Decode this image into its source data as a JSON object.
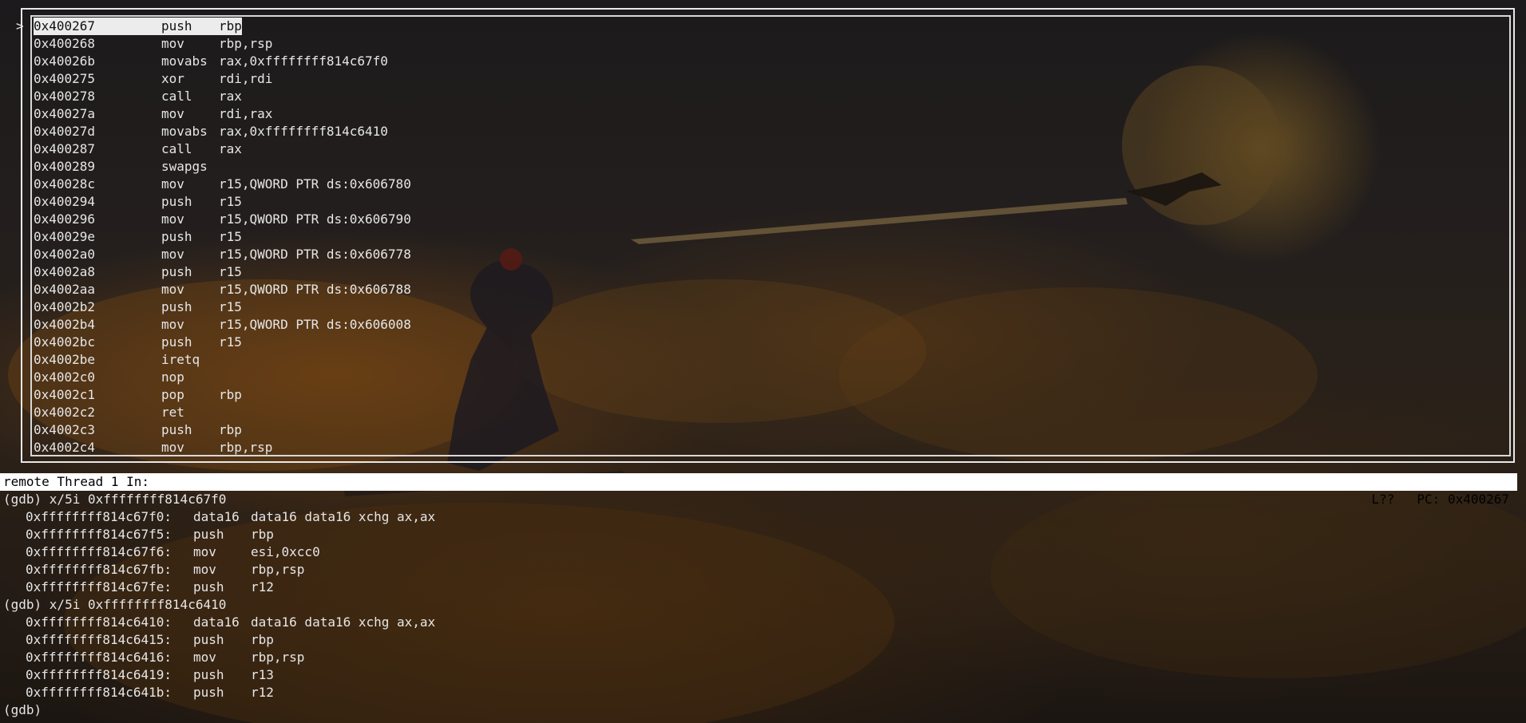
{
  "asm": {
    "cursor_marker": ">",
    "lines": [
      {
        "addr": "0x400267",
        "mnemonic": "push",
        "operands": "rbp"
      },
      {
        "addr": "0x400268",
        "mnemonic": "mov",
        "operands": "rbp,rsp"
      },
      {
        "addr": "0x40026b",
        "mnemonic": "movabs",
        "operands": "rax,0xffffffff814c67f0"
      },
      {
        "addr": "0x400275",
        "mnemonic": "xor",
        "operands": "rdi,rdi"
      },
      {
        "addr": "0x400278",
        "mnemonic": "call",
        "operands": "rax"
      },
      {
        "addr": "0x40027a",
        "mnemonic": "mov",
        "operands": "rdi,rax"
      },
      {
        "addr": "0x40027d",
        "mnemonic": "movabs",
        "operands": "rax,0xffffffff814c6410"
      },
      {
        "addr": "0x400287",
        "mnemonic": "call",
        "operands": "rax"
      },
      {
        "addr": "0x400289",
        "mnemonic": "swapgs",
        "operands": ""
      },
      {
        "addr": "0x40028c",
        "mnemonic": "mov",
        "operands": "r15,QWORD PTR ds:0x606780"
      },
      {
        "addr": "0x400294",
        "mnemonic": "push",
        "operands": "r15"
      },
      {
        "addr": "0x400296",
        "mnemonic": "mov",
        "operands": "r15,QWORD PTR ds:0x606790"
      },
      {
        "addr": "0x40029e",
        "mnemonic": "push",
        "operands": "r15"
      },
      {
        "addr": "0x4002a0",
        "mnemonic": "mov",
        "operands": "r15,QWORD PTR ds:0x606778"
      },
      {
        "addr": "0x4002a8",
        "mnemonic": "push",
        "operands": "r15"
      },
      {
        "addr": "0x4002aa",
        "mnemonic": "mov",
        "operands": "r15,QWORD PTR ds:0x606788"
      },
      {
        "addr": "0x4002b2",
        "mnemonic": "push",
        "operands": "r15"
      },
      {
        "addr": "0x4002b4",
        "mnemonic": "mov",
        "operands": "r15,QWORD PTR ds:0x606008"
      },
      {
        "addr": "0x4002bc",
        "mnemonic": "push",
        "operands": "r15"
      },
      {
        "addr": "0x4002be",
        "mnemonic": "iretq",
        "operands": ""
      },
      {
        "addr": "0x4002c0",
        "mnemonic": "nop",
        "operands": ""
      },
      {
        "addr": "0x4002c1",
        "mnemonic": "pop",
        "operands": "rbp"
      },
      {
        "addr": "0x4002c2",
        "mnemonic": "ret",
        "operands": ""
      },
      {
        "addr": "0x4002c3",
        "mnemonic": "push",
        "operands": "rbp"
      },
      {
        "addr": "0x4002c4",
        "mnemonic": "mov",
        "operands": "rbp,rsp"
      }
    ]
  },
  "status": {
    "left": "remote Thread 1 In:",
    "line": "L??",
    "pc": "PC: 0x400267"
  },
  "console": {
    "blocks": [
      {
        "command": "(gdb) x/5i 0xffffffff814c67f0",
        "instructions": [
          {
            "addr": "0xffffffff814c67f0:",
            "mnemonic": "data16",
            "operands": "data16 data16 xchg ax,ax"
          },
          {
            "addr": "0xffffffff814c67f5:",
            "mnemonic": "push",
            "operands": "rbp"
          },
          {
            "addr": "0xffffffff814c67f6:",
            "mnemonic": "mov",
            "operands": "esi,0xcc0"
          },
          {
            "addr": "0xffffffff814c67fb:",
            "mnemonic": "mov",
            "operands": "rbp,rsp"
          },
          {
            "addr": "0xffffffff814c67fe:",
            "mnemonic": "push",
            "operands": "r12"
          }
        ]
      },
      {
        "command": "(gdb) x/5i 0xffffffff814c6410",
        "instructions": [
          {
            "addr": "0xffffffff814c6410:",
            "mnemonic": "data16",
            "operands": "data16 data16 xchg ax,ax"
          },
          {
            "addr": "0xffffffff814c6415:",
            "mnemonic": "push",
            "operands": "rbp"
          },
          {
            "addr": "0xffffffff814c6416:",
            "mnemonic": "mov",
            "operands": "rbp,rsp"
          },
          {
            "addr": "0xffffffff814c6419:",
            "mnemonic": "push",
            "operands": "r13"
          },
          {
            "addr": "0xffffffff814c641b:",
            "mnemonic": "push",
            "operands": "r12"
          }
        ]
      }
    ],
    "prompt": "(gdb)"
  }
}
